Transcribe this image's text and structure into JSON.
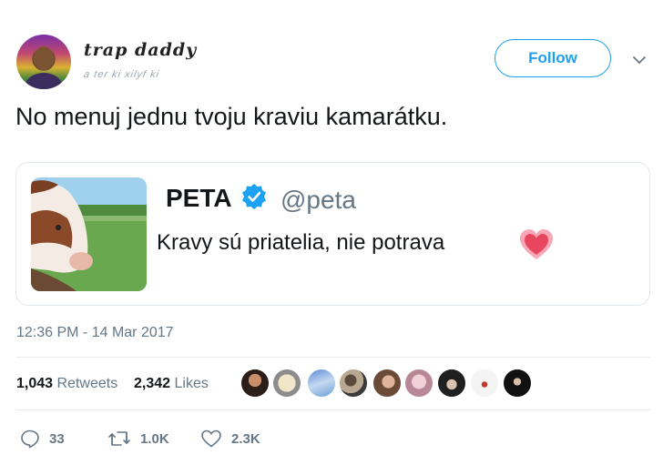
{
  "author": {
    "display_name": "trap daddy",
    "handle_scribble": "a ter ki xilyf ki"
  },
  "follow_label": "Follow",
  "tweet_text": "No menuj jednu tvoju kraviu kamarátku.",
  "quoted": {
    "name": "PETA",
    "handle": "@peta",
    "text": "Kravy sú priatelia, nie potrava"
  },
  "timestamp": "12:36 PM - 14 Mar 2017",
  "stats": {
    "retweets_count": "1,043",
    "retweets_label": "Retweets",
    "likes_count": "2,342",
    "likes_label": "Likes"
  },
  "actions": {
    "replies": "33",
    "retweets": "1.0K",
    "likes": "2.3K"
  },
  "colors": {
    "accent": "#1da1f2",
    "secondary_text": "#657786",
    "heart_emoji": "#e8455f"
  }
}
